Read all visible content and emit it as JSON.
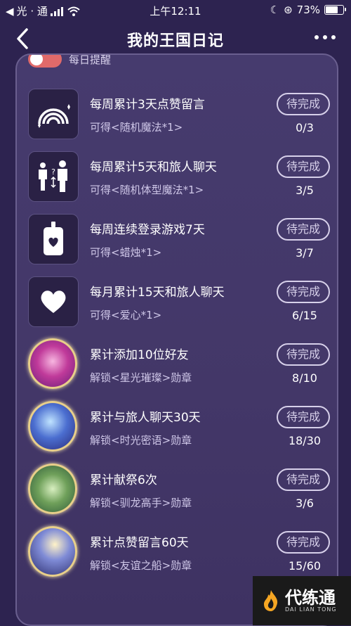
{
  "status_bar": {
    "carrier": "光 · 通",
    "time": "上午12:11",
    "battery": "73%"
  },
  "navbar": {
    "title": "我的王国日记"
  },
  "peek": {
    "label": "每日提醒"
  },
  "tasks": [
    {
      "icon": "rainbow-icon",
      "title": "每周累计3天点赞留言",
      "reward": "可得<随机魔法*1>",
      "status": "待完成",
      "progress": "0/3"
    },
    {
      "icon": "travelers-icon",
      "title": "每周累计5天和旅人聊天",
      "reward": "可得<随机体型魔法*1>",
      "status": "待完成",
      "progress": "3/5"
    },
    {
      "icon": "candle-icon",
      "title": "每周连续登录游戏7天",
      "reward": "可得<蜡烛*1>",
      "status": "待完成",
      "progress": "3/7"
    },
    {
      "icon": "heart-icon",
      "title": "每月累计15天和旅人聊天",
      "reward": "可得<爱心*1>",
      "status": "待完成",
      "progress": "6/15"
    },
    {
      "icon": "starlight-medal-icon",
      "title": "累计添加10位好友",
      "reward": "解锁<星光璀璨>勋章",
      "status": "待完成",
      "progress": "8/10"
    },
    {
      "icon": "whisper-medal-icon",
      "title": "累计与旅人聊天30天",
      "reward": "解锁<时光密语>勋章",
      "status": "待完成",
      "progress": "18/30"
    },
    {
      "icon": "dragon-medal-icon",
      "title": "累计献祭6次",
      "reward": "解锁<驯龙高手>勋章",
      "status": "待完成",
      "progress": "3/6"
    },
    {
      "icon": "ship-medal-icon",
      "title": "累计点赞留言60天",
      "reward": "解锁<友谊之船>勋章",
      "status": "待完成",
      "progress": "15/60"
    }
  ],
  "watermark": {
    "text": "代练通",
    "sub": "DAI LIAN TONG"
  }
}
